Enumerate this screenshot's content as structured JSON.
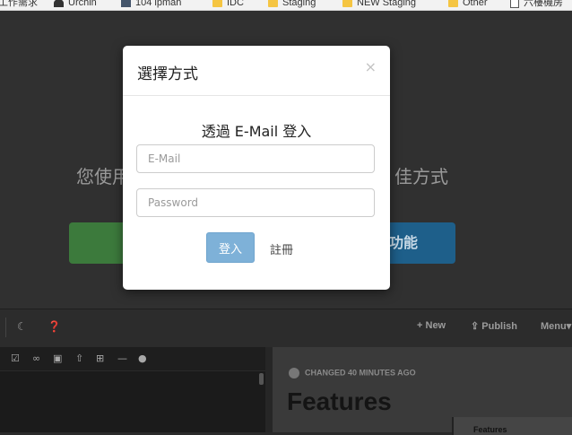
{
  "bookmarks": [
    {
      "label": "工作需求",
      "icon": "none-icon"
    },
    {
      "label": "Urchin",
      "icon": "urchin-icon"
    },
    {
      "label": "104 ipman",
      "icon": "ipman-icon"
    },
    {
      "label": "IDC",
      "icon": "folder-icon"
    },
    {
      "label": "Staging",
      "icon": "folder-icon"
    },
    {
      "label": "NEW Staging",
      "icon": "folder-icon"
    },
    {
      "label": "Other",
      "icon": "folder-icon"
    },
    {
      "label": "六樓機房",
      "icon": "page-icon"
    }
  ],
  "hero": {
    "text_left": "您使用",
    "text_right": "佳方式",
    "blue_button_text": "功能"
  },
  "editor": {
    "toolbar_right": {
      "new_label": "New",
      "publish_label": "Publish",
      "menu_label": "Menu"
    },
    "changed_text": "CHANGED 40 MINUTES AGO",
    "preview_title": "Features",
    "toc_label": "Features"
  },
  "modal": {
    "title": "選擇方式",
    "close_glyph": "×",
    "subtitle": "透過 E-Mail 登入",
    "email_placeholder": "E-Mail",
    "password_placeholder": "Password",
    "login_label": "登入",
    "register_label": "註冊"
  },
  "colors": {
    "primary_button": "#7eb1d8",
    "overlay": "#303030"
  }
}
